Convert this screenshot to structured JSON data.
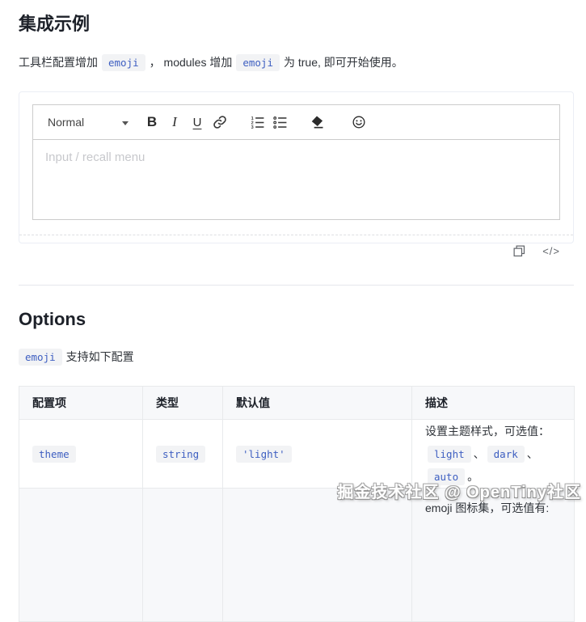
{
  "header": {
    "title": "集成示例"
  },
  "intro": {
    "seg1": "工具栏配置增加",
    "code1": "emoji",
    "seg2": "， modules 增加",
    "code2": "emoji",
    "seg3": "为 true, 即可开始使用。"
  },
  "editor": {
    "picker_label": "Normal",
    "bold_label": "B",
    "italic_label": "I",
    "underline_label": "U",
    "placeholder": "Input / recall menu"
  },
  "demo_footer": {
    "code_icon_label": "</>"
  },
  "options": {
    "heading": "Options",
    "sub_code": "emoji",
    "sub_text": "支持如下配置"
  },
  "table": {
    "headers": [
      "配置项",
      "类型",
      "默认值",
      "描述"
    ],
    "rows": [
      {
        "name": "theme",
        "type": "string",
        "default": "'light'",
        "desc_line1": "设置主题样式，可选值：",
        "desc_codes": [
          "light",
          "dark",
          "auto"
        ],
        "desc_sep": "、",
        "desc_end": "。"
      },
      {
        "name": "",
        "type": "",
        "default": "",
        "desc_line1": "emoji 图标集，可选值有:"
      }
    ]
  },
  "watermark": "掘金技术社区 @ OpenTiny社区",
  "colors": {
    "code_text": "#3e5fc1",
    "code_bg": "#f2f3f5",
    "demo_border": "#ebeef5",
    "editor_border": "#cccccc",
    "table_border": "#e8eaec",
    "stripe_bg": "#f7f8fa"
  }
}
